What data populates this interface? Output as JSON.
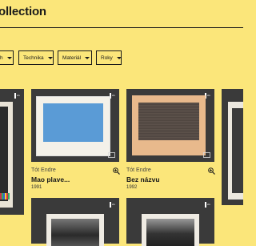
{
  "header": {
    "title": "ollection"
  },
  "filters": [
    {
      "label": "h"
    },
    {
      "label": "Technika"
    },
    {
      "label": "Materiál"
    },
    {
      "label": "Roky"
    }
  ],
  "cards": [
    {
      "artist": "Tót Endre",
      "title": "Mao plave...",
      "year": "1991",
      "swatch": "#5a9bd6"
    },
    {
      "artist": "Tót Endre",
      "title": "Bez názvu",
      "year": "1992",
      "swatch": "#5a4a42"
    }
  ],
  "colors": {
    "background": "#fbe67a",
    "card": "#3a3a3a",
    "paper": "#f0ece2",
    "peach": "#e8b98c"
  }
}
